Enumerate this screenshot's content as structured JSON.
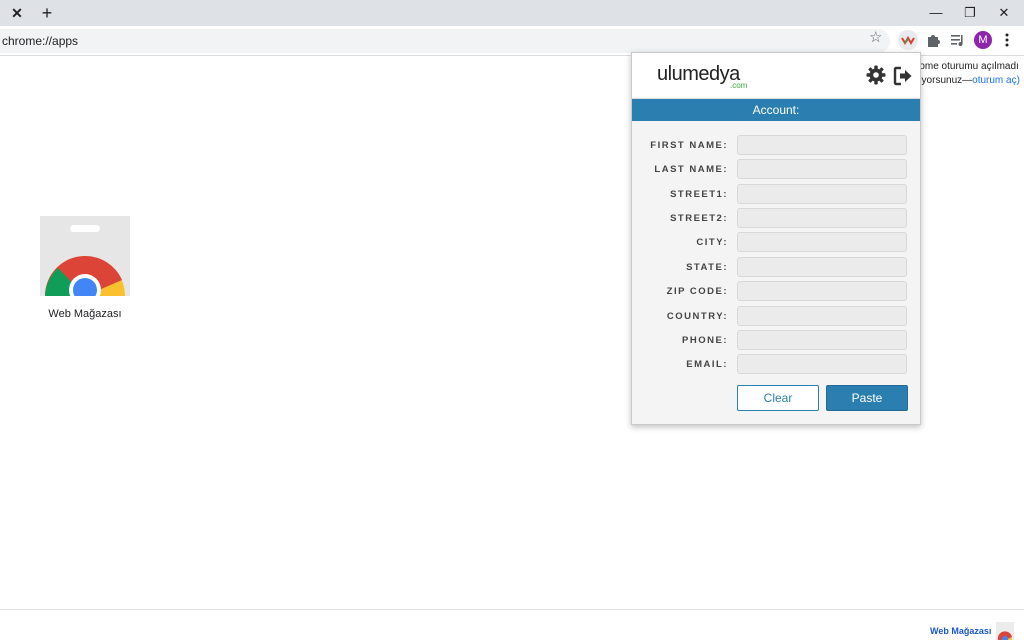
{
  "browser": {
    "tab_close": "✕",
    "new_tab": "+",
    "window_controls": {
      "minimize": "—",
      "restore": "❐",
      "close": "✕"
    },
    "url": "chrome://apps",
    "avatar_letter": "M",
    "icons": [
      "close-icon",
      "plus-icon",
      "minimize-icon",
      "restore-icon",
      "close-icon",
      "star-icon",
      "ulumedya-extension-icon",
      "puzzle-icon",
      "media-icon",
      "avatar",
      "kebab-menu-icon"
    ]
  },
  "page": {
    "app_label": "Web Mağazası",
    "signin_line1": "rome oturumu açılmadı",
    "signin_line2_prefix": "nyorsunuz—",
    "signin_link": "oturum aç)",
    "bottom_link": "Web Mağazası"
  },
  "popup": {
    "logo_text": "ulumedya",
    "logo_sub": ".com",
    "header_title": "Account:",
    "fields": [
      {
        "label": "FIRST NAME:",
        "value": ""
      },
      {
        "label": "LAST NAME:",
        "value": ""
      },
      {
        "label": "STREET1:",
        "value": ""
      },
      {
        "label": "STREET2:",
        "value": ""
      },
      {
        "label": "CITY:",
        "value": ""
      },
      {
        "label": "STATE:",
        "value": ""
      },
      {
        "label": "ZIP CODE:",
        "value": ""
      },
      {
        "label": "COUNTRY:",
        "value": ""
      },
      {
        "label": "PHONE:",
        "value": ""
      },
      {
        "label": "EMAIL:",
        "value": ""
      }
    ],
    "clear_label": "Clear",
    "paste_label": "Paste"
  },
  "colors": {
    "accent": "#2b7fb0",
    "avatar": "#8e24aa",
    "link": "#1a73e8"
  }
}
